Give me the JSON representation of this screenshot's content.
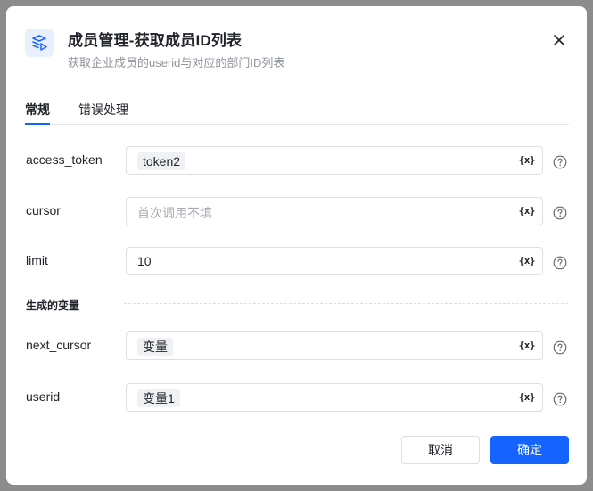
{
  "dialog": {
    "title": "成员管理-获取成员ID列表",
    "subtitle": "获取企业成员的userid与对应的部门ID列表"
  },
  "tabs": [
    {
      "label": "常规",
      "active": true
    },
    {
      "label": "错误处理",
      "active": false
    }
  ],
  "fields": {
    "access_token": {
      "label": "access_token",
      "tag": "token2"
    },
    "cursor": {
      "label": "cursor",
      "placeholder": "首次调用不填"
    },
    "limit": {
      "label": "limit",
      "value": "10"
    }
  },
  "outputs": {
    "section_label": "生成的变量",
    "next_cursor": {
      "label": "next_cursor",
      "tag": "变量"
    },
    "userid": {
      "label": "userid",
      "tag": "变量1"
    }
  },
  "variable_icon_text": "{x}",
  "buttons": {
    "cancel": "取消",
    "ok": "确定"
  },
  "colors": {
    "accent": "#1664ff",
    "overlay": "#8c8c8c"
  }
}
